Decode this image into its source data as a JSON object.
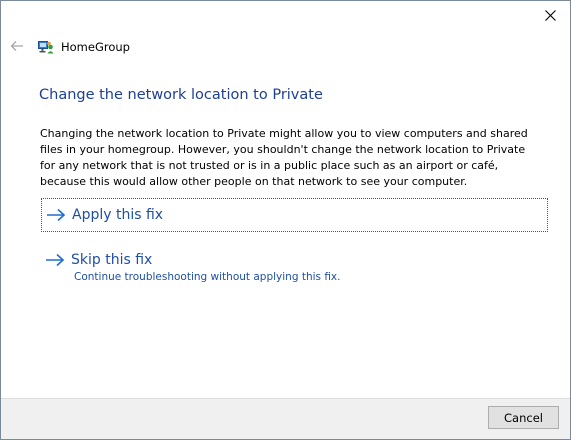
{
  "window": {
    "title": "HomeGroup"
  },
  "icons": {
    "close": "close-icon",
    "back": "back-arrow-icon",
    "app": "homegroup-icon",
    "arrow": "right-arrow-icon"
  },
  "content": {
    "heading": "Change the network location to Private",
    "description": "Changing the network location to Private might allow you to view computers and shared files in your homegroup. However, you shouldn't change the network location to Private for any network that is not trusted or is in a public place such as an airport or café, because this would allow other people on that network to see your computer."
  },
  "options": {
    "apply": {
      "label": "Apply this fix"
    },
    "skip": {
      "label": "Skip this fix",
      "sublabel": "Continue troubleshooting without applying this fix."
    }
  },
  "footer": {
    "cancel_label": "Cancel"
  },
  "colors": {
    "heading": "#1e3f94",
    "link": "#1f4fa5",
    "footer_bg": "#f0f0f0"
  }
}
